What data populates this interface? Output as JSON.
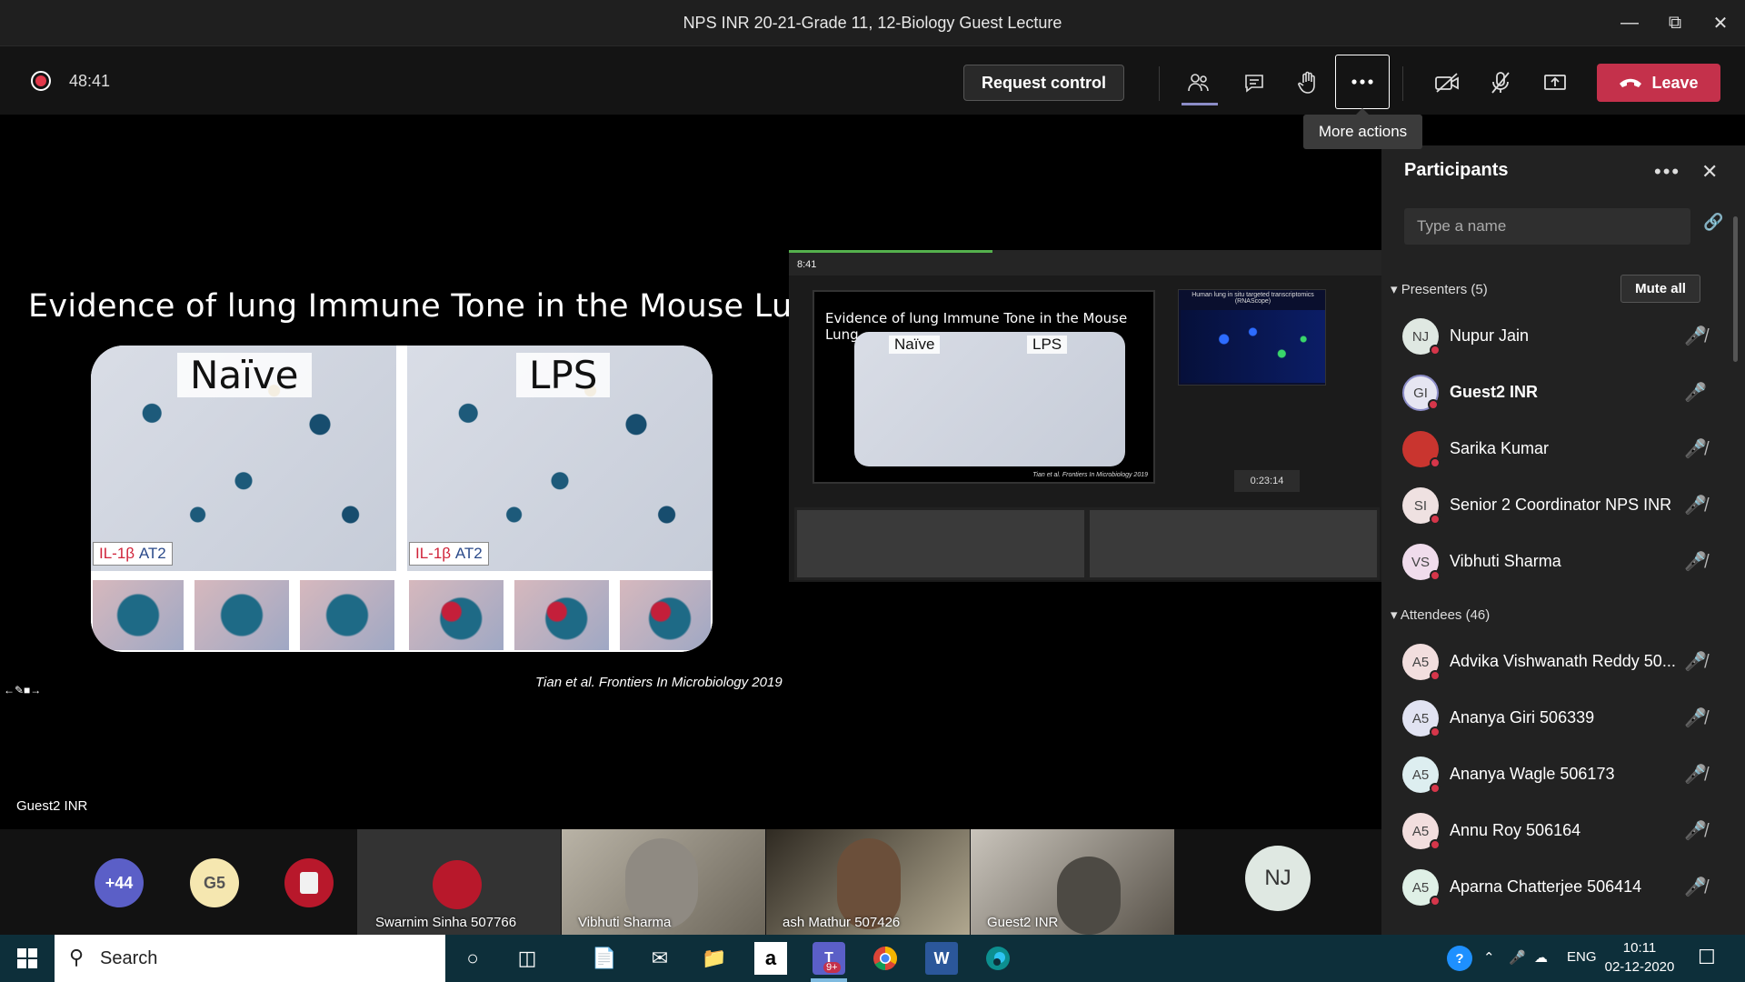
{
  "window": {
    "title": "NPS INR 20-21-Grade 11, 12-Biology Guest Lecture",
    "minimize": "—",
    "restore": "⧉",
    "close": "✕"
  },
  "meeting": {
    "timer": "48:41",
    "request_control": "Request control",
    "leave_label": "Leave",
    "more_actions_tooltip": "More actions",
    "recording_color": "#e0384a",
    "leave_color": "#c4314b"
  },
  "slide": {
    "title": "Evidence of lung Immune Tone in the Mouse Lung",
    "panel_left_label": "Naïve",
    "panel_right_label": "LPS",
    "sub_label_red": "IL-1β",
    "sub_label_sep": "/",
    "sub_label_blue": "AT2",
    "citation": "Tian et al. Frontiers In Microbiology 2019"
  },
  "shared_screen": {
    "time": "8:41",
    "inner_title": "Evidence of lung Immune Tone in the Mouse Lung",
    "inner_left": "Naïve",
    "inner_right": "LPS",
    "inner_citation": "Tian et al. Frontiers In Microbiology 2019",
    "side_title": "Human lung in situ targeted transcriptomics (RNAScope)",
    "video_timer": "0:23:14"
  },
  "stage": {
    "speaker_name": "Guest2 INR"
  },
  "strip": {
    "overflow_count": "+44",
    "g5": "G5",
    "tiles": [
      {
        "name": "Swarnim Sinha 507766"
      },
      {
        "name": "Vibhuti Sharma"
      },
      {
        "name": "ash Mathur 507426"
      },
      {
        "name": "Guest2 INR"
      }
    ],
    "nj": "NJ"
  },
  "participants": {
    "title": "Participants",
    "search_placeholder": "Type a name",
    "presenters_header": "Presenters (5)",
    "mute_all": "Mute all",
    "presenters": [
      {
        "initials": "NJ",
        "name": "Nupur Jain"
      },
      {
        "initials": "GI",
        "name": "Guest2 INR"
      },
      {
        "initials": "",
        "name": "Sarika Kumar"
      },
      {
        "initials": "SI",
        "name": "Senior 2 Coordinator NPS INR"
      },
      {
        "initials": "VS",
        "name": "Vibhuti Sharma"
      }
    ],
    "attendees_header": "Attendees (46)",
    "attendees": [
      {
        "initials": "A5",
        "name": "Advika Vishwanath Reddy 50..."
      },
      {
        "initials": "A5",
        "name": "Ananya Giri 506339"
      },
      {
        "initials": "A5",
        "name": "Ananya Wagle 506173"
      },
      {
        "initials": "A5",
        "name": "Annu Roy 506164"
      },
      {
        "initials": "A5",
        "name": "Aparna Chatterjee 506414"
      }
    ]
  },
  "taskbar": {
    "search": "Search",
    "lang": "ENG",
    "time": "10:11",
    "date": "02-12-2020",
    "teams_badge": "9+"
  }
}
